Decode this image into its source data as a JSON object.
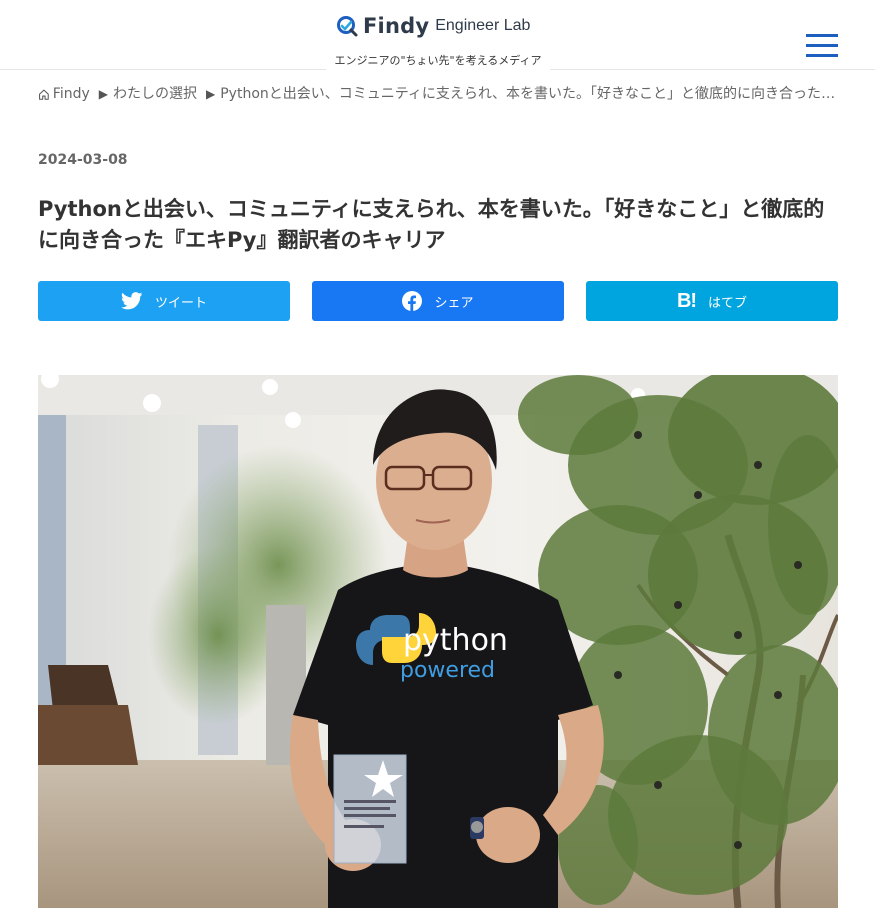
{
  "header": {
    "logo_name": "Findy",
    "logo_sub": "Engineer Lab",
    "tagline": "エンジニアの\"ちょい先\"を考えるメディア",
    "menu_icon": "hamburger-menu-icon"
  },
  "breadcrumb": {
    "home": "Findy",
    "items": [
      "わたしの選択",
      "Pythonと出会い、コミュニティに支えられ、本を書いた。「好きなこと」と徹底的に向き合った『エキPy』翻訳者のキャリア"
    ]
  },
  "article": {
    "date": "2024-03-08",
    "title": "Pythonと出会い、コミュニティに支えられ、本を書いた。「好きなこと」と徹底的に向き合った『エキPy』翻訳者のキャリア"
  },
  "share": {
    "tweet": "ツイート",
    "facebook": "シェア",
    "hatena": "はてブ",
    "hatena_mark": "B!",
    "colors": {
      "twitter": "#1da1f2",
      "facebook": "#1877f2",
      "hatena": "#00a4de"
    }
  },
  "hero": {
    "shirt_text_1": "python",
    "shirt_text_2": "powered"
  }
}
